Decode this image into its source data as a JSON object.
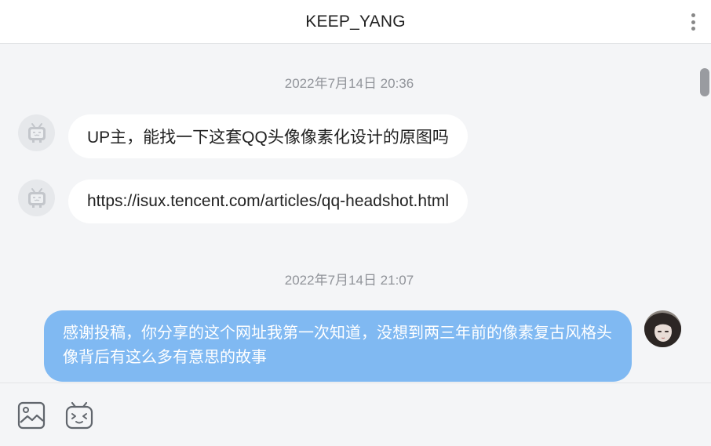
{
  "header": {
    "title": "KEEP_YANG",
    "menu_icon": "more-vertical-icon"
  },
  "messages": [
    {
      "type": "time",
      "text": "2022年7月14日 20:36"
    },
    {
      "type": "incoming",
      "text": "UP主，能找一下这套QQ头像像素化设计的原图吗",
      "avatar": "bilibili-tv-avatar-icon"
    },
    {
      "type": "incoming",
      "text": "https://isux.tencent.com/articles/qq-headshot.html",
      "avatar": "bilibili-tv-avatar-icon"
    },
    {
      "type": "time",
      "text": "2022年7月14日 21:07"
    },
    {
      "type": "outgoing",
      "text": "感谢投稿，你分享的这个网址我第一次知道，没想到两三年前的像素复古风格头像背后有这么多有意思的故事",
      "avatar": "user-photo-avatar"
    }
  ],
  "toolbar": {
    "image_icon": "image-icon",
    "emoji_icon": "bilibili-emoji-icon"
  },
  "colors": {
    "outgoing_bubble": "#80b9f2",
    "incoming_bubble": "#ffffff",
    "background": "#f4f5f7"
  }
}
